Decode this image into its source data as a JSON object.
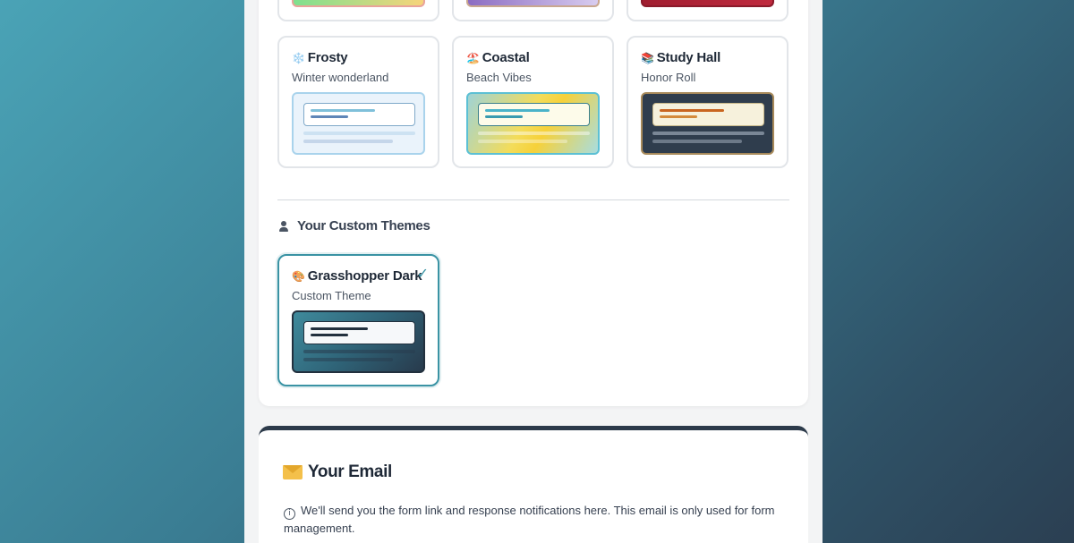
{
  "themes_top_row": [
    {
      "name": "theme-top-1",
      "strip_colors": [
        "#7ee08e",
        "#f7d47a"
      ],
      "border": "#e9a39a"
    },
    {
      "name": "theme-top-2",
      "strip_colors": [
        "#8c6cc2",
        "#d8ccef"
      ],
      "border": "#c9a78f"
    },
    {
      "name": "theme-top-3",
      "strip_colors": [
        "#a01e30",
        "#c02a3e"
      ],
      "border": "#8a1a2a"
    }
  ],
  "themes": [
    {
      "emoji": "❄️",
      "title": "Frosty",
      "subtitle": "Winter wonderland"
    },
    {
      "emoji": "🏖️",
      "title": "Coastal",
      "subtitle": "Beach Vibes"
    },
    {
      "emoji": "📚",
      "title": "Study Hall",
      "subtitle": "Honor Roll"
    }
  ],
  "custom_section": {
    "title": "Your Custom Themes",
    "themes": [
      {
        "emoji": "🎨",
        "title": "Grasshopper Dark",
        "subtitle": "Custom Theme",
        "selected": true,
        "check": "✓"
      }
    ]
  },
  "email_section": {
    "title": "Your Email",
    "info_glyph": "i",
    "note": "We'll send you the form link and response notifications here. This email is only used for form management."
  },
  "colors": {
    "accent": "#3a93a4",
    "frosty_bg": "#eaf3fb",
    "coastal_bg": "#f3dc5a",
    "study_bg": "#2f3d4d",
    "grasshopper_bg": "#2f6478"
  }
}
